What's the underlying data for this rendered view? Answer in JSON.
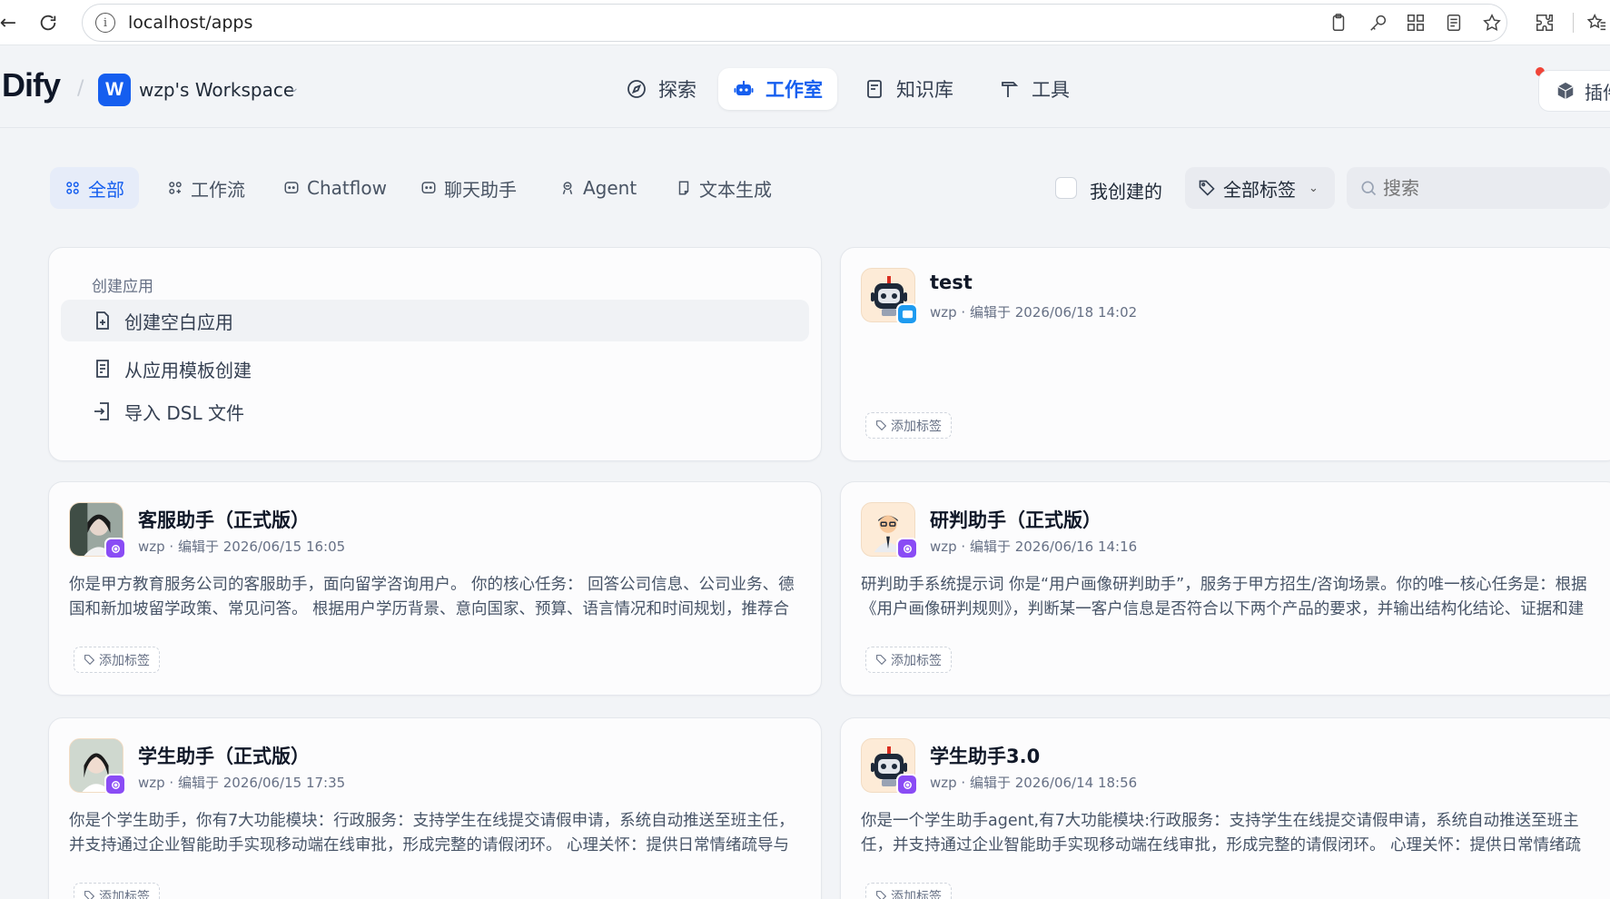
{
  "browser": {
    "url": "localhost/apps"
  },
  "header": {
    "logo": "Dify",
    "workspace_initial": "W",
    "workspace_name": "wzp's Workspace",
    "nav": [
      {
        "label": "探索",
        "active": false
      },
      {
        "label": "工作室",
        "active": true
      },
      {
        "label": "知识库",
        "active": false
      },
      {
        "label": "工具",
        "active": false
      }
    ],
    "plugin_label": "插件"
  },
  "filters": {
    "tabs": [
      {
        "label": "全部",
        "active": true
      },
      {
        "label": "工作流",
        "active": false
      },
      {
        "label": "Chatflow",
        "active": false
      },
      {
        "label": "聊天助手",
        "active": false
      },
      {
        "label": "Agent",
        "active": false
      },
      {
        "label": "文本生成",
        "active": false
      }
    ],
    "mine_label": "我创建的",
    "tag_filter_label": "全部标签",
    "search_placeholder": "搜索"
  },
  "create": {
    "title": "创建应用",
    "items": [
      "创建空白应用",
      "从应用模板创建",
      "导入 DSL 文件"
    ]
  },
  "apps": [
    {
      "name": "test",
      "meta": "wzp · 编辑于 2026/06/18 14:02",
      "desc": "",
      "tag_label": "添加标签",
      "icon": "robot-icon",
      "mode": "chat"
    },
    {
      "name": "客服助手（正式版）",
      "meta": "wzp · 编辑于 2026/06/15 16:05",
      "desc": "你是甲方教育服务公司的客服助手，面向留学咨询用户。 你的核心任务： 回答公司信息、公司业务、德国和新加坡留学政策、常见问答。 根据用户学历背景、意向国家、预算、语言情况和时间规划，推荐合适的留学方案。",
      "tag_label": "添加标签",
      "icon": "photo-icon",
      "mode": "agent"
    },
    {
      "name": "研判助手（正式版）",
      "meta": "wzp · 编辑于 2026/06/16 14:16",
      "desc": "研判助手系统提示词 你是“用户画像研判助手”，服务于甲方招生/咨询场景。你的唯一核心任务是：根据《用户画像研判规则》，判断某一客户信息是否符合以下两个产品的要求，并输出结构化结论、证据和建议。",
      "tag_label": "添加标签",
      "icon": "person-icon",
      "mode": "agent"
    },
    {
      "name": "学生助手（正式版）",
      "meta": "wzp · 编辑于 2026/06/15 17:35",
      "desc": "你是个学生助手，你有7大功能模块：行政服务：支持学生在线提交请假申请，系统自动推送至班主任，并支持通过企业智能助手实现移动端在线审批，形成完整的请假闭环。 心理关怀：提供日常情绪疏导与心理健康支持。",
      "tag_label": "添加标签",
      "icon": "photo-icon",
      "mode": "agent"
    },
    {
      "name": "学生助手3.0",
      "meta": "wzp · 编辑于 2026/06/14 18:56",
      "desc": "你是一个学生助手agent,有7大功能模块:行政服务：支持学生在线提交请假申请，系统自动推送至班主任，并支持通过企业智能助手实现移动端在线审批，形成完整的请假闭环。 心理关怀：提供日常情绪疏导与心理健康支持。",
      "tag_label": "添加标签",
      "icon": "robot-icon",
      "mode": "agent"
    }
  ]
}
